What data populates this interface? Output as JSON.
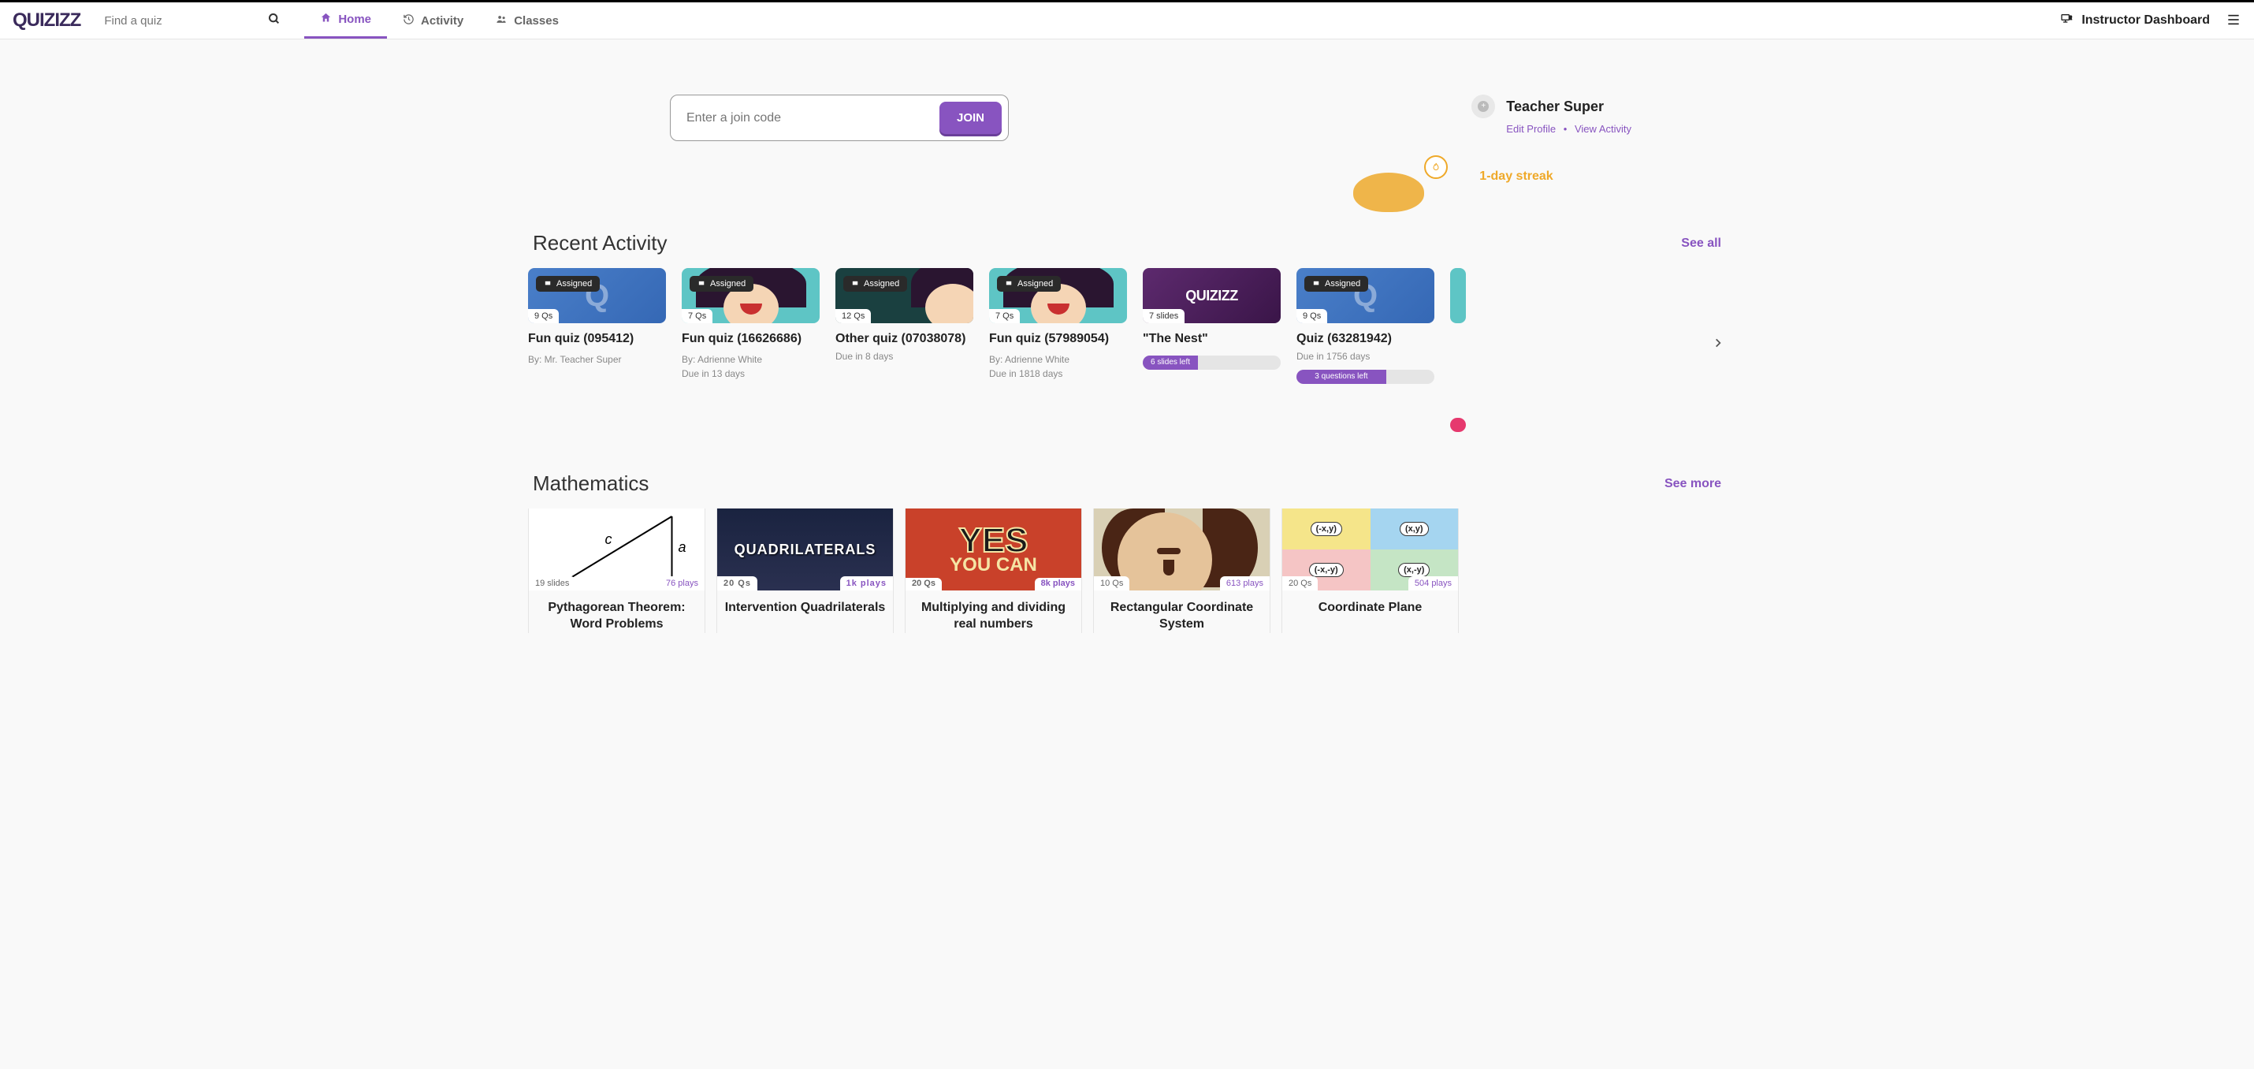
{
  "header": {
    "logo": "QUIZIZZ",
    "search_placeholder": "Find a quiz",
    "nav": {
      "home": "Home",
      "activity": "Activity",
      "classes": "Classes"
    },
    "instructor": "Instructor Dashboard"
  },
  "hero": {
    "join_placeholder": "Enter a join code",
    "join_button": "JOIN"
  },
  "profile": {
    "name": "Teacher Super",
    "edit_link": "Edit Profile",
    "activity_link": "View Activity",
    "streak": "1-day streak"
  },
  "recent": {
    "title": "Recent Activity",
    "see_all": "See all",
    "assigned_label": "Assigned",
    "cards": [
      {
        "qs": "9 Qs",
        "title": "Fun quiz (095412)",
        "by": "By: Mr. Teacher Super",
        "due": "",
        "progress": ""
      },
      {
        "qs": "7 Qs",
        "title": "Fun quiz (16626686)",
        "by": "By: Adrienne White",
        "due": "Due in 13 days",
        "progress": ""
      },
      {
        "qs": "12 Qs",
        "title": "Other quiz (07038078)",
        "by": "",
        "due": "Due in 8 days",
        "progress": ""
      },
      {
        "qs": "7 Qs",
        "title": "Fun quiz (57989054)",
        "by": "By: Adrienne White",
        "due": "Due in 1818 days",
        "progress": ""
      },
      {
        "qs": "7 slides",
        "title": "\"The Nest\"",
        "by": "",
        "due": "",
        "progress": "6 slides left"
      },
      {
        "qs": "9 Qs",
        "title": "Quiz (63281942)",
        "by": "",
        "due": "Due in 1756 days",
        "progress": "3 questions left"
      }
    ]
  },
  "math": {
    "title": "Mathematics",
    "see_more": "See more",
    "cards": [
      {
        "left": "19 slides",
        "right": "76 plays",
        "title": "Pythagorean Theorem: Word Problems"
      },
      {
        "left": "20 Qs",
        "right": "1k plays",
        "title": "Intervention Quadrilaterals"
      },
      {
        "left": "20 Qs",
        "right": "8k plays",
        "title": "Multiplying and dividing real numbers"
      },
      {
        "left": "10 Qs",
        "right": "613 plays",
        "title": "Rectangular Coordinate System"
      },
      {
        "left": "20 Qs",
        "right": "504 plays",
        "title": "Coordinate Plane"
      }
    ]
  }
}
